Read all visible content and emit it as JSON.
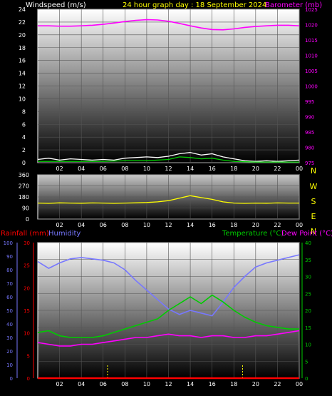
{
  "header": {
    "windspeed_label": "Windspeed (m/s)",
    "title": "24 hour graph day : 18 September 2024",
    "barometer_label": "Barometer (mb)"
  },
  "lower_header": {
    "rainfall_label": "Rainfall (mm)",
    "humidity_label": "Humidity",
    "temperature_label": "Temperature (°C)",
    "dewpoint_label": "Dew Point (°C)"
  },
  "colors": {
    "background": "#000000",
    "windspeed": "#ffffff",
    "wind_gust": "#00cc00",
    "barometer": "#ff00ff",
    "wind_direction": "#ffff00",
    "humidity": "#7777ff",
    "temperature": "#00cc00",
    "dew_point": "#ff00ff",
    "rainfall": "#ff0000",
    "axis_text_windspeed": "#ffffff",
    "axis_text_barometer": "#ff00ff",
    "axis_text_rain": "#ff0000",
    "axis_text_humidity": "#7777ff",
    "axis_text_temperature": "#00cc00"
  },
  "chart_data": [
    {
      "id": "wind_barometer",
      "type": "line",
      "x_tick_labels": [
        "02",
        "04",
        "06",
        "08",
        "10",
        "12",
        "14",
        "16",
        "18",
        "20",
        "22",
        "00"
      ],
      "left_axis": {
        "label": "Windspeed (m/s)",
        "ylim": [
          0,
          24
        ],
        "ticks": [
          "0",
          "2",
          "4",
          "6",
          "8",
          "10",
          "12",
          "14",
          "16",
          "18",
          "20",
          "22",
          "24"
        ]
      },
      "right_axis": {
        "label": "Barometer (mb)",
        "ylim": [
          975,
          1025
        ],
        "ticks": [
          "975",
          "980",
          "985",
          "990",
          "995",
          "1000",
          "1005",
          "1010",
          "1015",
          "1020",
          "1025"
        ]
      },
      "series": [
        {
          "name": "Barometer",
          "axis": "right",
          "x": [
            0,
            1,
            2,
            3,
            4,
            5,
            6,
            7,
            8,
            9,
            10,
            11,
            12,
            13,
            14,
            15,
            16,
            17,
            18,
            19,
            20,
            21,
            22,
            23,
            24
          ],
          "values": [
            1019.6,
            1019.6,
            1019.5,
            1019.5,
            1019.6,
            1019.8,
            1020.1,
            1020.5,
            1021.0,
            1021.4,
            1021.6,
            1021.5,
            1021.1,
            1020.4,
            1019.6,
            1018.9,
            1018.4,
            1018.3,
            1018.6,
            1019.1,
            1019.4,
            1019.6,
            1019.8,
            1019.8,
            1019.6
          ]
        },
        {
          "name": "Windspeed",
          "axis": "left",
          "x": [
            0,
            1,
            2,
            3,
            4,
            5,
            6,
            7,
            8,
            9,
            10,
            11,
            12,
            13,
            14,
            15,
            16,
            17,
            18,
            19,
            20,
            21,
            22,
            23,
            24
          ],
          "values": [
            0.5,
            0.7,
            0.4,
            0.6,
            0.5,
            0.4,
            0.5,
            0.4,
            0.7,
            0.8,
            0.9,
            0.8,
            1.0,
            1.4,
            1.6,
            1.2,
            1.4,
            0.9,
            0.6,
            0.3,
            0.2,
            0.3,
            0.2,
            0.3,
            0.4
          ]
        },
        {
          "name": "Wind gust",
          "axis": "left",
          "x": [
            0,
            2,
            4,
            6,
            8,
            10,
            12,
            13,
            14,
            15,
            16,
            17,
            18,
            20,
            22,
            24
          ],
          "values": [
            0.2,
            0.2,
            0.2,
            0.2,
            0.3,
            0.3,
            0.5,
            0.9,
            0.8,
            0.6,
            0.7,
            0.4,
            0.2,
            0.1,
            0.1,
            0.1
          ]
        }
      ]
    },
    {
      "id": "wind_direction",
      "type": "line",
      "x_tick_labels": [
        "02",
        "04",
        "06",
        "08",
        "10",
        "12",
        "14",
        "16",
        "18",
        "20",
        "22",
        "00"
      ],
      "left_axis": {
        "ylim": [
          0,
          360
        ],
        "ticks": [
          "0",
          "90",
          "180",
          "270",
          "360"
        ]
      },
      "right_axis": {
        "labels": [
          "N",
          "W",
          "S",
          "E",
          "N"
        ]
      },
      "series": [
        {
          "name": "Wind direction",
          "x": [
            0,
            1,
            2,
            3,
            4,
            5,
            6,
            7,
            8,
            9,
            10,
            11,
            12,
            13,
            14,
            15,
            16,
            17,
            18,
            19,
            20,
            21,
            22,
            23,
            24
          ],
          "values": [
            130,
            128,
            132,
            130,
            129,
            131,
            130,
            128,
            130,
            132,
            135,
            140,
            150,
            170,
            190,
            175,
            160,
            140,
            130,
            128,
            130,
            129,
            131,
            130,
            130
          ]
        }
      ]
    },
    {
      "id": "temp_humidity_rain",
      "type": "line",
      "x_tick_labels": [
        "02",
        "04",
        "06",
        "08",
        "10",
        "12",
        "14",
        "16",
        "18",
        "20",
        "22",
        "00"
      ],
      "rain_axis": {
        "label": "Rainfall (mm)",
        "ylim": [
          0,
          30
        ],
        "ticks": [
          "0",
          "5",
          "10",
          "15",
          "20",
          "25",
          "30"
        ]
      },
      "humidity_axis": {
        "label": "Humidity",
        "ylim": [
          0,
          100
        ],
        "ticks": [
          "0",
          "10",
          "20",
          "30",
          "40",
          "50",
          "60",
          "70",
          "80",
          "90",
          "100"
        ]
      },
      "temperature_axis": {
        "label": "Temperature (°C)",
        "ylim": [
          0,
          40
        ],
        "ticks": [
          "0",
          "5",
          "10",
          "15",
          "20",
          "25",
          "30",
          "35",
          "40"
        ]
      },
      "series": [
        {
          "name": "Humidity",
          "axis": "humidity",
          "x": [
            0,
            1,
            2,
            3,
            4,
            5,
            6,
            7,
            8,
            9,
            10,
            11,
            12,
            13,
            14,
            15,
            16,
            17,
            18,
            19,
            20,
            21,
            22,
            23,
            24
          ],
          "values": [
            86,
            81,
            85,
            88,
            89,
            88,
            87,
            85,
            80,
            72,
            65,
            58,
            51,
            47,
            50,
            48,
            46,
            56,
            67,
            75,
            82,
            85,
            87,
            89,
            91
          ]
        },
        {
          "name": "Temperature",
          "axis": "temperature",
          "x": [
            0,
            1,
            2,
            3,
            4,
            5,
            6,
            7,
            8,
            9,
            10,
            11,
            12,
            13,
            14,
            15,
            16,
            17,
            18,
            19,
            20,
            21,
            22,
            23,
            24
          ],
          "values": [
            13.5,
            14.0,
            12.5,
            12.0,
            12.0,
            12.0,
            12.5,
            13.5,
            14.5,
            15.5,
            16.5,
            17.5,
            20.0,
            22.0,
            24.0,
            22.0,
            24.5,
            22.5,
            20.0,
            18.0,
            16.5,
            15.5,
            15.0,
            14.5,
            14.5
          ]
        },
        {
          "name": "Dew Point",
          "axis": "temperature",
          "x": [
            0,
            1,
            2,
            3,
            4,
            5,
            6,
            7,
            8,
            9,
            10,
            11,
            12,
            13,
            14,
            15,
            16,
            17,
            18,
            19,
            20,
            21,
            22,
            23,
            24
          ],
          "values": [
            10.5,
            10.0,
            9.5,
            9.5,
            10.0,
            10.0,
            10.5,
            11.0,
            11.5,
            12.0,
            12.0,
            12.5,
            13.0,
            12.5,
            12.5,
            12.0,
            12.5,
            12.5,
            12.0,
            12.0,
            12.5,
            12.5,
            13.0,
            13.5,
            14.0
          ]
        },
        {
          "name": "Rainfall",
          "axis": "rain",
          "x": [
            0,
            24
          ],
          "values": [
            0,
            0
          ]
        }
      ]
    }
  ]
}
